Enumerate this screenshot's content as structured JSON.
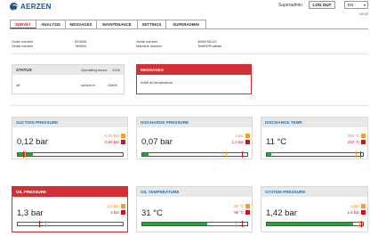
{
  "header": {
    "logo_text": "AERZEN",
    "user": "Superadmin",
    "logout_label": "LOG OUT",
    "language": "EN",
    "version": "V8.02"
  },
  "tabs": [
    {
      "label": "SURVEY",
      "active": true
    },
    {
      "label": "ANALYSIS",
      "active": false
    },
    {
      "label": "MESSAGES",
      "active": false
    },
    {
      "label": "MAINTENANCE",
      "active": false
    },
    {
      "label": "SETTINGS",
      "active": false
    },
    {
      "label": "SUPERADMIN",
      "active": false
    }
  ],
  "info": {
    "order_number_label": "Order number",
    "order_number": "523456",
    "serial_number_label": "Serial number",
    "serial_number": "789654",
    "serial_number2_label": "Serial number",
    "serial_number2": "4066706122",
    "machine_number_label": "Machine number",
    "machine_number": "TestRDProtblak"
  },
  "status": {
    "title": "STATUS",
    "operating_hours_label": "Operating hours:",
    "operating_hours": "120h",
    "state": "off",
    "service_label": "service in",
    "service_value": "2360h"
  },
  "messages": {
    "title": "MESSAGES",
    "text": "A069 oil temperature"
  },
  "gauges": {
    "suction": {
      "title": "SUCTION PRESSURE",
      "value": "0,12 bar",
      "warn": "-0.04 bar",
      "alarm": "-0.05 bar",
      "level": 0.14
    },
    "discharge": {
      "title": "DISCHARGE PRESSURE",
      "value": "0,07 bar",
      "warn": "1 bar",
      "alarm": "1.2 bar",
      "level": 0.06
    },
    "temp": {
      "title": "DISCHARGE TEMP.",
      "value": "11 °C",
      "warn": "200 °C",
      "alarm": "210 °C",
      "level": 0.05
    },
    "oil_pressure": {
      "title": "OIL PRESSURE",
      "value": "1,3 bar",
      "warn": "2.5 bar",
      "alarm": "2 bar",
      "level": 0.0
    },
    "oil_temp": {
      "title": "OIL TEMPERATURE",
      "value": "31 °C",
      "warn": "90 °C",
      "alarm": "95 °C",
      "level": 0.62
    },
    "system_pressure": {
      "title": "SYSTEM PRESSURE",
      "value": "1,42 bar",
      "warn": "3 bar",
      "alarm": "1.6 bar",
      "level": 0.9
    }
  },
  "colors": {
    "accent": "#c8171f",
    "alarm_header": "#d32f36",
    "ok": "#2f9e3f",
    "warn": "#f0a030",
    "brand": "#1f4f8f"
  }
}
